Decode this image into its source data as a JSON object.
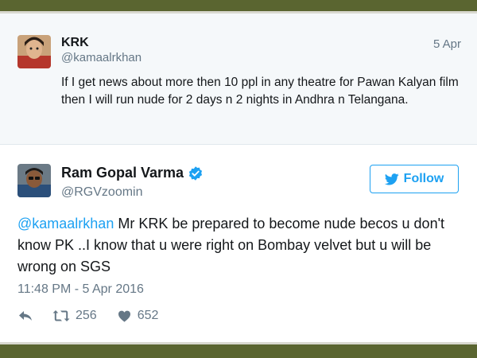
{
  "quoted_tweet": {
    "name": "KRK",
    "handle": "@kamaalrkhan",
    "date": "5 Apr",
    "text": "If I get news about more then 10 ppl in any theatre for Pawan Kalyan film then I will run nude for 2 days n 2 nights in Andhra n Telangana."
  },
  "main_tweet": {
    "name": "Ram Gopal Varma",
    "handle": "@RGVzoomin",
    "follow_label": "Follow",
    "mention": "@kamaalrkhan",
    "text": " Mr KRK be prepared to become nude becos u don't know PK ..I know that u were right on Bombay velvet but u will be wrong on SGS",
    "timestamp": "11:48 PM - 5 Apr 2016",
    "retweet_count": "256",
    "like_count": "652"
  },
  "icons": {
    "verified": "verified-badge-icon",
    "bird": "twitter-bird-icon",
    "reply": "reply-icon",
    "retweet": "retweet-icon",
    "like": "heart-icon"
  },
  "colors": {
    "accent": "#1da1f2",
    "frame": "#5a6530",
    "secondary_text": "#657786",
    "quoted_bg": "#f5f8fa"
  }
}
